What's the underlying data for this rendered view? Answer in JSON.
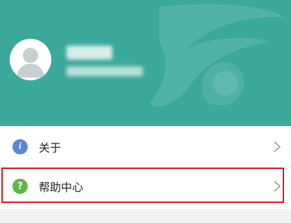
{
  "profile": {
    "name_redacted": "",
    "phone_redacted": ""
  },
  "menu": {
    "about": {
      "label": "关于",
      "icon": "info-icon"
    },
    "help": {
      "label": "帮助中心",
      "icon": "question-icon"
    }
  },
  "colors": {
    "header": "#3aa99a",
    "highlight": "#e0131b",
    "info_icon": "#5b86d8",
    "question_icon": "#5fb447"
  }
}
